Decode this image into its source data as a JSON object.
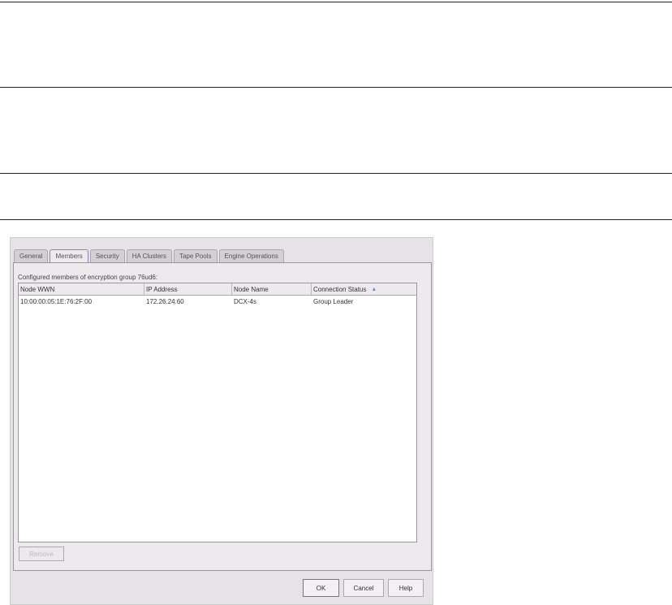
{
  "tabs": [
    "General",
    "Members",
    "Security",
    "HA Clusters",
    "Tape Pools",
    "Engine Operations"
  ],
  "active_tab": "Members",
  "caption": "Configured members of encryption group 76ud6:",
  "table": {
    "columns": [
      "Node WWN",
      "IP Address",
      "Node Name",
      "Connection Status"
    ],
    "sort_indicator": "▲",
    "rows": [
      [
        "10:00:00:05:1E:76:2F:00",
        "172.26.24.60",
        "DCX-4s",
        "Group Leader"
      ]
    ]
  },
  "buttons": {
    "remove": "Remove",
    "ok": "OK",
    "cancel": "Cancel",
    "help": "Help"
  }
}
